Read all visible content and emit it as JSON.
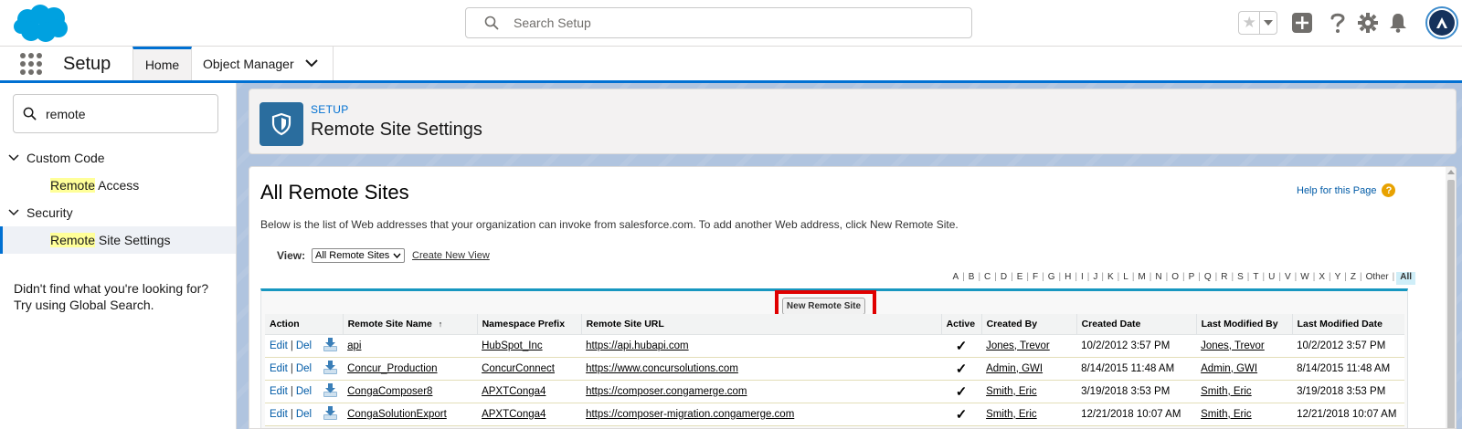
{
  "header": {
    "search_placeholder": "Search Setup"
  },
  "nav": {
    "app_name": "Setup",
    "tabs": [
      {
        "label": "Home"
      },
      {
        "label": "Object Manager"
      }
    ]
  },
  "sidebar": {
    "quickfind_value": "remote",
    "sections": [
      {
        "label": "Custom Code",
        "items": [
          {
            "highlight": "Remote",
            "rest": " Access"
          }
        ]
      },
      {
        "label": "Security",
        "items": [
          {
            "highlight": "Remote",
            "rest": " Site Settings"
          }
        ]
      }
    ],
    "not_found_line1": "Didn't find what you're looking for?",
    "not_found_line2": "Try using Global Search."
  },
  "page_header": {
    "kicker": "SETUP",
    "title": "Remote Site Settings"
  },
  "content": {
    "title": "All Remote Sites",
    "help_link": "Help for this Page",
    "help_icon": "?",
    "intro": "Below is the list of Web addresses that your organization can invoke from salesforce.com. To add another Web address, click New Remote Site.",
    "view_label": "View:",
    "view_selected": "All Remote Sites",
    "create_view": "Create New View",
    "alpha": [
      "A",
      "B",
      "C",
      "D",
      "E",
      "F",
      "G",
      "H",
      "I",
      "J",
      "K",
      "L",
      "M",
      "N",
      "O",
      "P",
      "Q",
      "R",
      "S",
      "T",
      "U",
      "V",
      "W",
      "X",
      "Y",
      "Z",
      "Other",
      "All"
    ],
    "new_button": "New Remote Site"
  },
  "table": {
    "columns": [
      "Action",
      "Remote Site Name",
      "Namespace Prefix",
      "Remote Site URL",
      "Active",
      "Created By",
      "Created Date",
      "Last Modified By",
      "Last Modified Date"
    ],
    "sort_indicator": "↑",
    "edit_label": "Edit",
    "del_label": "Del",
    "action_sep": "|",
    "rows": [
      {
        "name": "api",
        "prefix": "HubSpot_Inc",
        "url": "https://api.hubapi.com",
        "active": "✓",
        "created_by": "Jones, Trevor",
        "created_date": "10/2/2012 3:57 PM",
        "modified_by": "Jones, Trevor",
        "modified_date": "10/2/2012 3:57 PM"
      },
      {
        "name": "Concur_Production",
        "prefix": "ConcurConnect",
        "url": "https://www.concursolutions.com",
        "active": "✓",
        "created_by": "Admin, GWI",
        "created_date": "8/14/2015 11:48 AM",
        "modified_by": "Admin, GWI",
        "modified_date": "8/14/2015 11:48 AM"
      },
      {
        "name": "CongaComposer8",
        "prefix": "APXTConga4",
        "url": "https://composer.congamerge.com",
        "active": "✓",
        "created_by": "Smith, Eric",
        "created_date": "3/19/2018 3:53 PM",
        "modified_by": "Smith, Eric",
        "modified_date": "3/19/2018 3:53 PM"
      },
      {
        "name": "CongaSolutionExport",
        "prefix": "APXTConga4",
        "url": "https://composer-migration.congamerge.com",
        "active": "✓",
        "created_by": "Smith, Eric",
        "created_date": "12/21/2018 10:07 AM",
        "modified_by": "Smith, Eric",
        "modified_date": "12/21/2018 10:07 AM"
      }
    ]
  },
  "colors": {
    "brand_blue": "#0070d2",
    "header_icon_bg": "#2a6d9e",
    "highlight": "#ffff99",
    "callout_red": "#e00000",
    "table_accent": "#1797c0"
  },
  "icons": {
    "logo": "salesforce-cloud-logo",
    "search": "search-icon",
    "favorites": "star-icon",
    "add": "plus-icon",
    "help": "question-icon",
    "settings": "gear-icon",
    "notifications": "bell-icon",
    "page": "shield-icon",
    "download": "download-icon"
  }
}
